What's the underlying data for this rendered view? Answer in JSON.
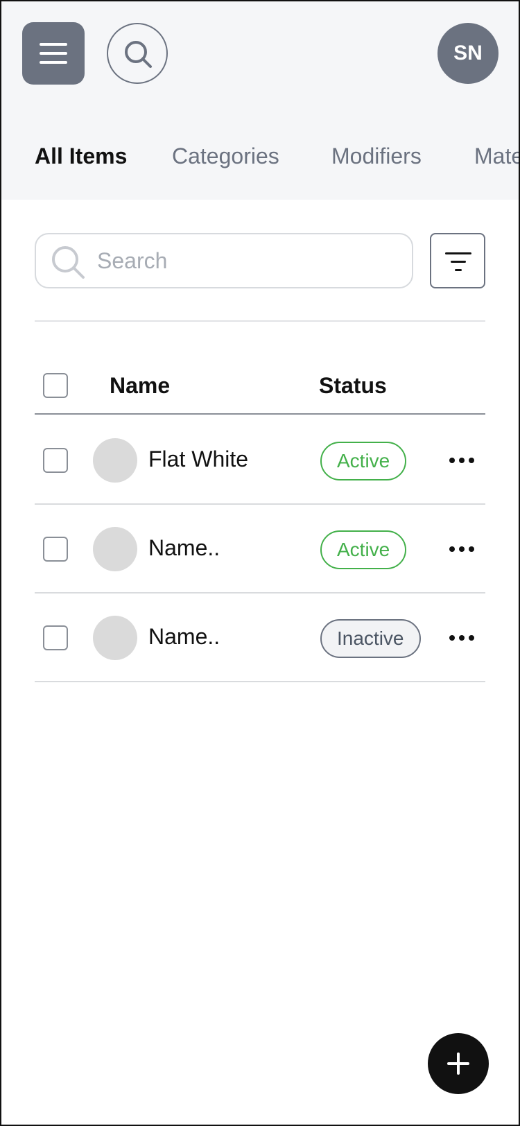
{
  "header": {
    "menu_icon": "hamburger-menu-icon",
    "search_icon": "search-icon",
    "avatar_initials": "SN"
  },
  "tabs": [
    {
      "label": "All Items",
      "active": true
    },
    {
      "label": "Categories",
      "active": false
    },
    {
      "label": "Modifiers",
      "active": false
    },
    {
      "label": "Mate",
      "active": false
    }
  ],
  "search": {
    "placeholder": "Search",
    "value": ""
  },
  "filter_icon": "filter-icon",
  "table": {
    "columns": {
      "name": "Name",
      "status": "Status"
    },
    "rows": [
      {
        "name": "Flat White",
        "status": "Active"
      },
      {
        "name": "Name..",
        "status": "Active"
      },
      {
        "name": "Name..",
        "status": "Inactive"
      }
    ]
  },
  "fab_icon": "plus-icon",
  "colors": {
    "header_bg": "#f5f6f8",
    "gray_button": "#6b7280",
    "active_green": "#43b04a",
    "fab_black": "#111111"
  }
}
